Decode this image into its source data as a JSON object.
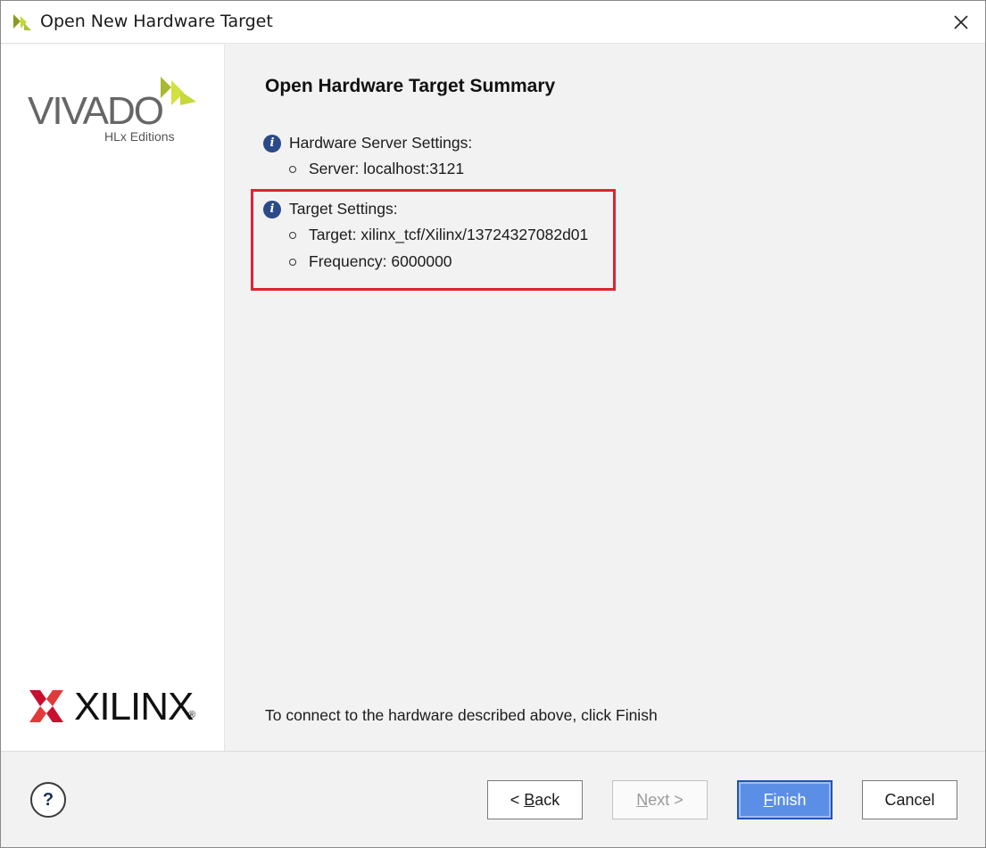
{
  "window": {
    "title": "Open New Hardware Target"
  },
  "sidebar": {
    "vivado_word": "VIVADO",
    "vivado_sub": "HLx Editions",
    "xilinx_word": "XILINX",
    "xilinx_reg": "®"
  },
  "main": {
    "heading": "Open Hardware Target Summary",
    "server_section": {
      "label": "Hardware Server Settings:",
      "items": [
        "Server: localhost:3121"
      ]
    },
    "target_section": {
      "label": "Target Settings:",
      "items": [
        "Target: xilinx_tcf/Xilinx/13724327082d01",
        "Frequency: 6000000"
      ]
    },
    "footer_message": "To connect to the hardware described above, click Finish"
  },
  "buttons": {
    "help": "?",
    "back_prefix": "< ",
    "back_mnemonic": "B",
    "back_rest": "ack",
    "next_mnemonic": "N",
    "next_rest": "ext >",
    "finish_mnemonic": "F",
    "finish_rest": "inish",
    "cancel": "Cancel"
  },
  "colors": {
    "highlight": "#e0232e",
    "info_icon": "#2a4a8a",
    "primary_button": "#5b8fe6",
    "vivado_green": "#a8c43a",
    "xilinx_red": "#c8102e"
  },
  "icons": {
    "title": "vivado-logo-icon",
    "close": "close-icon",
    "info": "info-icon",
    "help": "help-icon"
  }
}
